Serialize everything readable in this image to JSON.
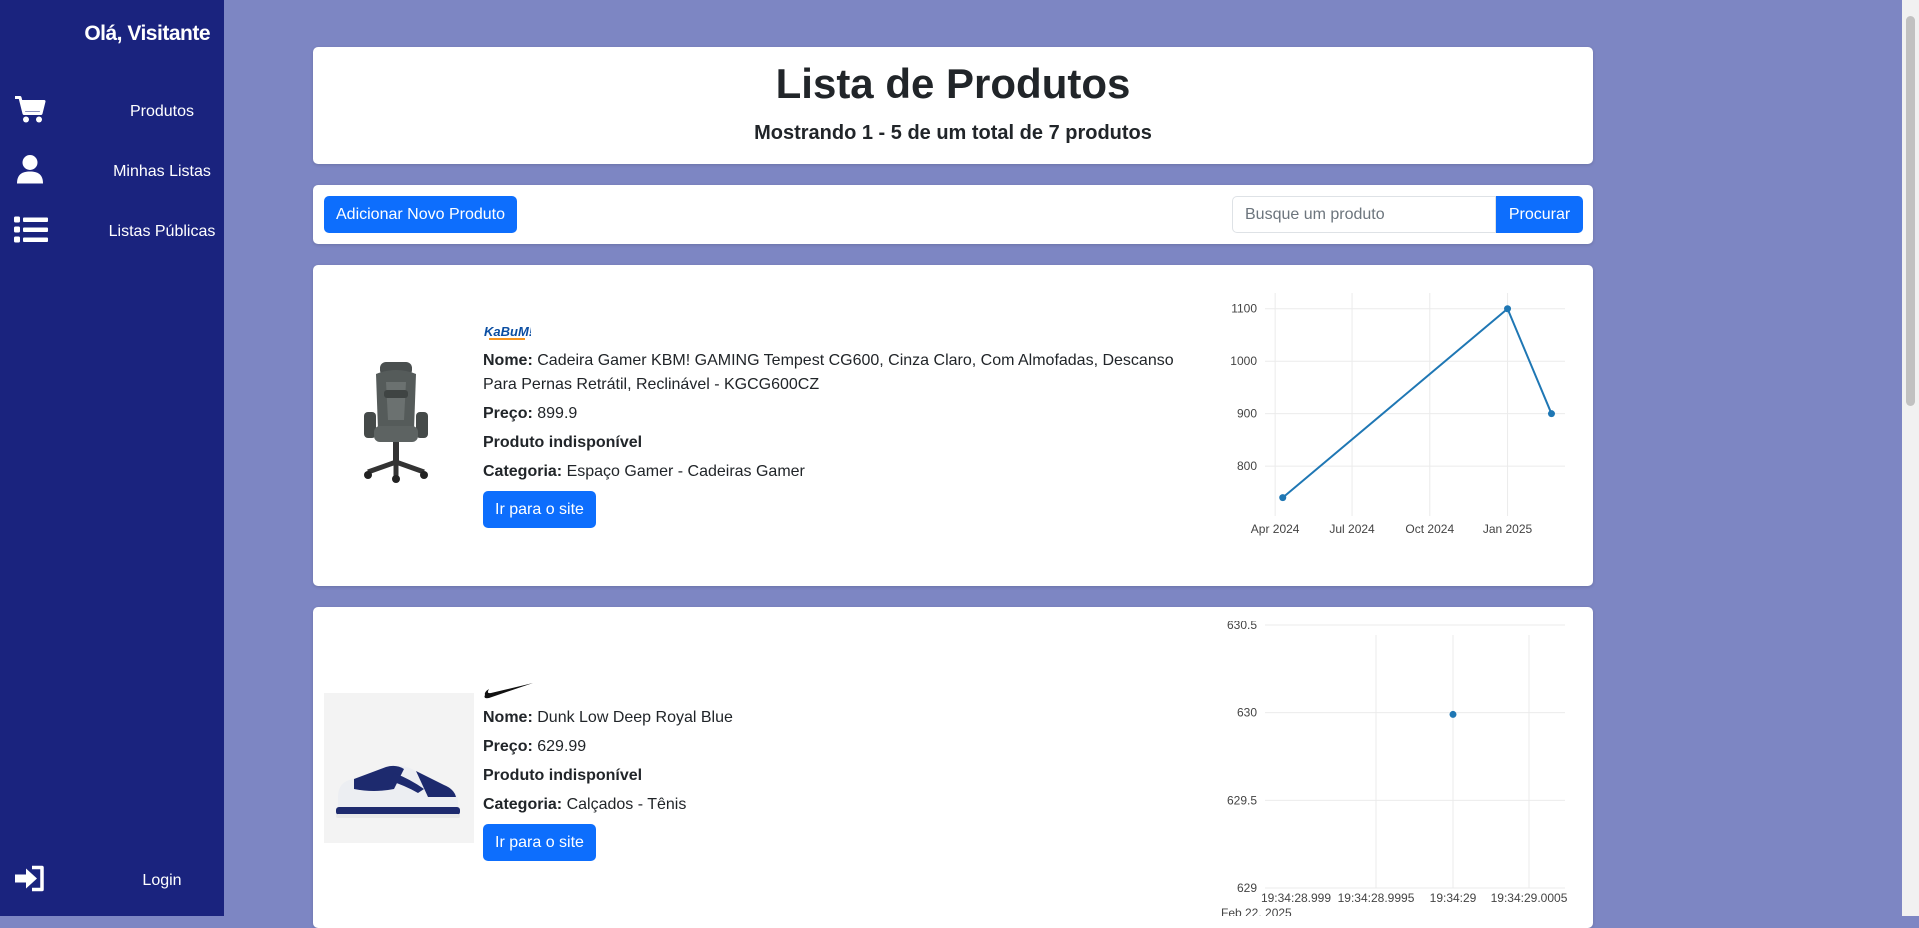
{
  "sidebar": {
    "greeting": "Olá, Visitante",
    "items": [
      {
        "label": "Produtos",
        "icon": "cart-icon"
      },
      {
        "label": "Minhas Listas",
        "icon": "user-icon"
      },
      {
        "label": "Listas Públicas",
        "icon": "list-icon"
      }
    ],
    "login": {
      "label": "Login",
      "icon": "sign-in-icon"
    }
  },
  "header": {
    "title": "Lista de Produtos",
    "subtitle": "Mostrando 1 - 5 de um total de 7 produtos"
  },
  "toolbar": {
    "add_label": "Adicionar Novo Produto",
    "search_placeholder": "Busque um produto",
    "search_label": "Procurar"
  },
  "products": [
    {
      "brand": "KaBuM!",
      "name_label": "Nome:",
      "name": "Cadeira Gamer KBM! GAMING Tempest CG600, Cinza Claro, Com Almofadas, Descanso Para Pernas Retrátil, Reclinável - KGCG600CZ",
      "price_label": "Preço:",
      "price": "899.9",
      "availability": "Produto indisponível",
      "category_label": "Categoria:",
      "category": "Espaço Gamer - Cadeiras Gamer",
      "button": "Ir para o site"
    },
    {
      "brand": "Nike",
      "name_label": "Nome:",
      "name": "Dunk Low Deep Royal Blue",
      "price_label": "Preço:",
      "price": "629.99",
      "availability": "Produto indisponível",
      "category_label": "Categoria:",
      "category": "Calçados - Tênis",
      "button": "Ir para o site"
    }
  ],
  "colors": {
    "sidebar": "#1a237e",
    "background": "#7d86c3",
    "primary": "#0d6efd",
    "line": "#1f77b4"
  },
  "chart_data": [
    {
      "type": "line",
      "x": [
        "2024-04-10",
        "2025-01-01",
        "2025-02-22"
      ],
      "y": [
        740,
        1100,
        900
      ],
      "xticks": [
        "Apr 2024",
        "Jul 2024",
        "Oct 2024",
        "Jan 2025"
      ],
      "yticks": [
        "800",
        "900",
        "1000",
        "1100"
      ],
      "ylim": [
        705,
        1130
      ],
      "grid": true
    },
    {
      "type": "scatter",
      "x": [
        "19:34:29"
      ],
      "y": [
        629.99
      ],
      "xticks": [
        "19:34:28.999",
        "19:34:28.9995",
        "19:34:29",
        "19:34:29.0005"
      ],
      "xsublabel": "Feb 22, 2025",
      "yticks": [
        "629",
        "629.5",
        "630",
        "630.5"
      ],
      "ylim": [
        629,
        630.5
      ],
      "grid": true
    }
  ]
}
